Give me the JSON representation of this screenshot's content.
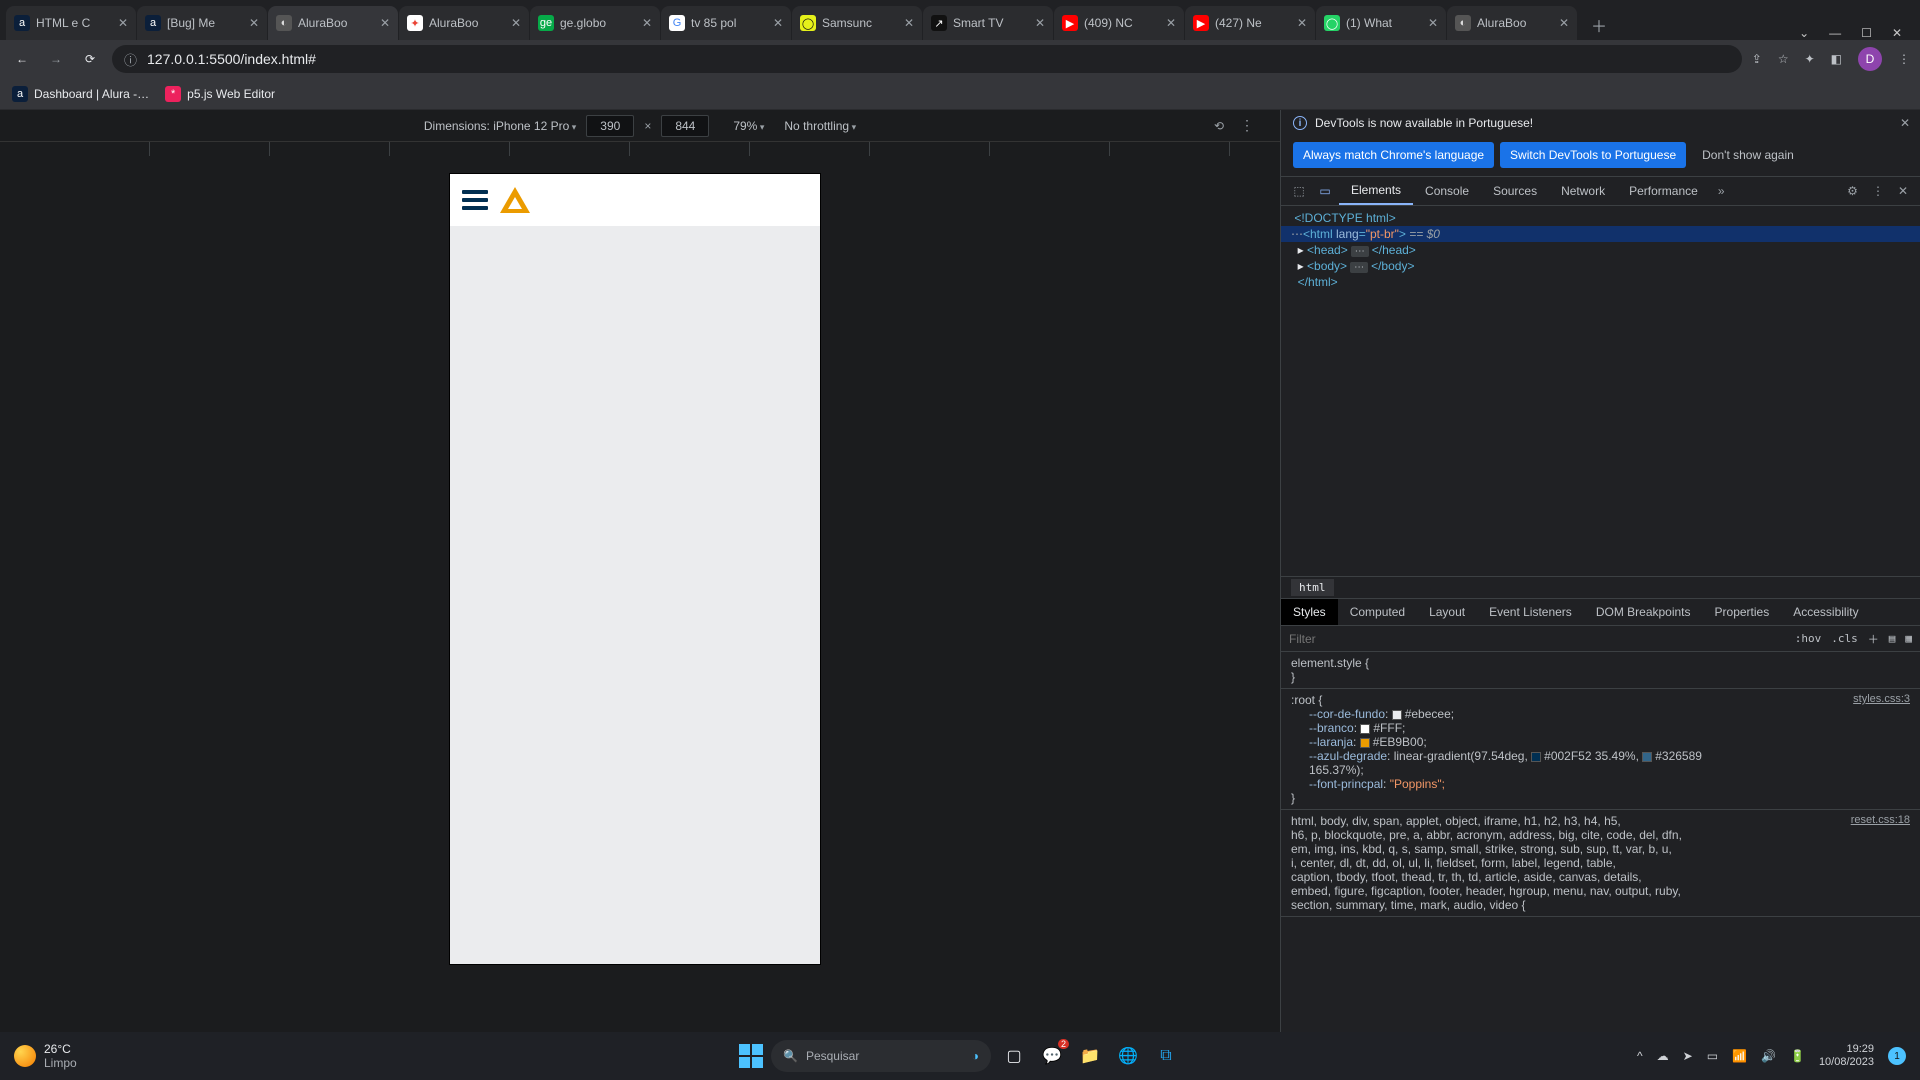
{
  "browser": {
    "tabs": [
      {
        "fav_bg": "#0b1f3a",
        "fav_fg": "#fff",
        "fav": "a",
        "title": "HTML e C"
      },
      {
        "fav_bg": "#0b1f3a",
        "fav_fg": "#fff",
        "fav": "a",
        "title": "[Bug] Me"
      },
      {
        "fav_bg": "#555",
        "fav_fg": "#ddd",
        "fav": "◐",
        "title": "AluraBoo",
        "active": true
      },
      {
        "fav_bg": "#fff",
        "fav_fg": "#ea4335",
        "fav": "✦",
        "title": "AluraBoo"
      },
      {
        "fav_bg": "#06aa48",
        "fav_fg": "#fff",
        "fav": "ge",
        "title": "ge.globo"
      },
      {
        "fav_bg": "#fff",
        "fav_fg": "#4285f4",
        "fav": "G",
        "title": "tv 85 pol"
      },
      {
        "fav_bg": "#e5f11a",
        "fav_fg": "#111",
        "fav": "◯",
        "title": "Samsunc"
      },
      {
        "fav_bg": "#111",
        "fav_fg": "#fff",
        "fav": "↗",
        "title": "Smart TV"
      },
      {
        "fav_bg": "#f00",
        "fav_fg": "#fff",
        "fav": "▶",
        "title": "(409) NC"
      },
      {
        "fav_bg": "#f00",
        "fav_fg": "#fff",
        "fav": "▶",
        "title": "(427) Ne"
      },
      {
        "fav_bg": "#25d366",
        "fav_fg": "#fff",
        "fav": "◯",
        "title": "(1) What"
      },
      {
        "fav_bg": "#555",
        "fav_fg": "#ddd",
        "fav": "◐",
        "title": "AluraBoo"
      }
    ],
    "url": "127.0.0.1:5500/index.html#",
    "avatar_letter": "D",
    "bookmarks": [
      {
        "fav_bg": "#0b1f3a",
        "fav_fg": "#fff",
        "fav": "a",
        "title": "Dashboard | Alura -…"
      },
      {
        "fav_bg": "#ed225d",
        "fav_fg": "#fff",
        "fav": "*",
        "title": "p5.js Web Editor"
      }
    ]
  },
  "device_bar": {
    "dimensions_label": "Dimensions: iPhone 12 Pro",
    "width": "390",
    "height": "844",
    "zoom": "79%",
    "throttling": "No throttling"
  },
  "devtools": {
    "banner": "DevTools is now available in Portuguese!",
    "btn_match": "Always match Chrome's language",
    "btn_switch": "Switch DevTools to Portuguese",
    "btn_dont": "Don't show again",
    "tabs": [
      "Elements",
      "Console",
      "Sources",
      "Network",
      "Performance"
    ],
    "active_tab": "Elements",
    "dom": {
      "l0": "<!DOCTYPE html>",
      "l1_open": "<html ",
      "l1_attr_n": "lang",
      "l1_attr_v": "\"pt-br\"",
      "l1_close": ">",
      "l1_eq": " == $0",
      "l2_open": "<head>",
      "l2_close": "</head>",
      "l3_open": "<body>",
      "l3_close": "</body>",
      "l4": "</html>"
    },
    "crumb": "html",
    "styles_tabs": [
      "Styles",
      "Computed",
      "Layout",
      "Event Listeners",
      "DOM Breakpoints",
      "Properties",
      "Accessibility"
    ],
    "active_styles_tab": "Styles",
    "filter_placeholder": "Filter",
    "hov": ":hov",
    "cls": ".cls",
    "rules": {
      "r0_sel": "element.style {",
      "r1_sel": ":root {",
      "r1_src": "styles.css:3",
      "r1_props": [
        {
          "n": "--cor-de-fundo",
          "swatch": "#ebecee",
          "v": "#ebecee;"
        },
        {
          "n": "--branco",
          "swatch": "#FFFFFF",
          "v": "#FFF;"
        },
        {
          "n": "--laranja",
          "swatch": "#EB9B00",
          "v": "#EB9B00;"
        },
        {
          "n": "--azul-degrade",
          "v": "linear-gradient(97.54deg, ",
          "swatch2": "#002F52",
          "v2": "#002F52 35.49%, ",
          "swatch3": "#326589",
          "v3": "#326589"
        },
        {
          "cont": "165.37%);"
        },
        {
          "n": "--font-princpal",
          "v": "\"Poppins\";",
          "is_str": true
        }
      ],
      "r2_sel": "html, body, div, span, applet, object, iframe, h1, h2, h3, h4, h5,",
      "r2_src": "reset.css:18",
      "r2_l2": "h6, p, blockquote, pre, a, abbr, acronym, address, big, cite, code, del, dfn,",
      "r2_l3": "em, img, ins, kbd, q, s, samp, small, strike, strong, sub, sup, tt, var, b, u,",
      "r2_l4": "i, center, dl, dt, dd, ol, ul, li, fieldset, form, label, legend, table,",
      "r2_l5": "caption, tbody, tfoot, thead, tr, th, td, article, aside, canvas, details,",
      "r2_l6": "embed, figure, figcaption, footer, header, hgroup, menu, nav, output, ruby,",
      "r2_l7": "section, summary, time, mark, audio, video {"
    }
  },
  "taskbar": {
    "temp": "26°C",
    "cond": "Limpo",
    "search_placeholder": "Pesquisar",
    "time": "19:29",
    "date": "10/08/2023",
    "notif_count": "1"
  }
}
